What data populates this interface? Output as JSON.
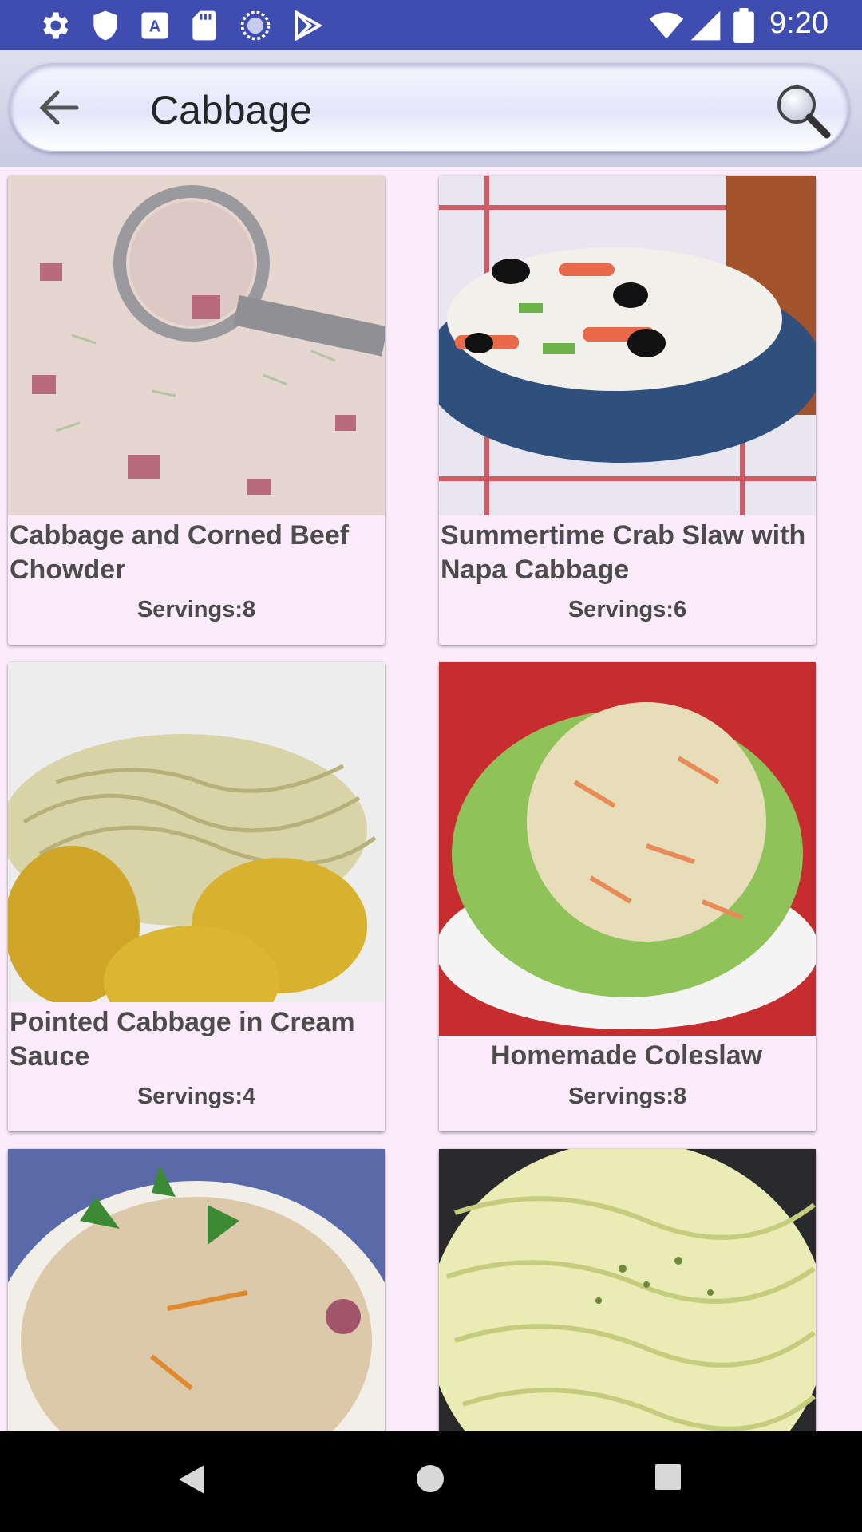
{
  "status_bar": {
    "time": "9:20",
    "left_icons": [
      "gear-icon",
      "shield-icon",
      "font-icon",
      "sd-card-icon",
      "sync-circle-icon",
      "play-store-icon"
    ],
    "right_icons": [
      "wifi-icon",
      "signal-icon",
      "battery-icon"
    ]
  },
  "app_bar": {
    "title": "Cabbage",
    "back_icon": "arrow-left-icon",
    "search_icon": "search-icon"
  },
  "recipes": [
    {
      "title": "Cabbage and Corned Beef Chowder",
      "servings": "Servings:8",
      "image": "chowder-photo"
    },
    {
      "title": "Summertime Crab Slaw with Napa Cabbage",
      "servings": "Servings:6",
      "image": "crab-slaw-photo"
    },
    {
      "title": "Pointed Cabbage in Cream Sauce",
      "servings": "Servings:4",
      "image": "pointed-cabbage-photo"
    },
    {
      "title": "Homemade Coleslaw",
      "servings": "Servings:8",
      "image": "coleslaw-photo"
    },
    {
      "title": "",
      "servings": "",
      "image": "cabbage-casserole-photo"
    },
    {
      "title": "",
      "servings": "",
      "image": "sauteed-cabbage-photo"
    }
  ],
  "nav_bar": {
    "back": "nav-back-icon",
    "home": "nav-home-icon",
    "recents": "nav-recents-icon"
  },
  "colors": {
    "status_bar": "#3f4db0",
    "page_background": "#fcecfb",
    "title_text": "#262626",
    "card_text": "#4c4c4c"
  }
}
